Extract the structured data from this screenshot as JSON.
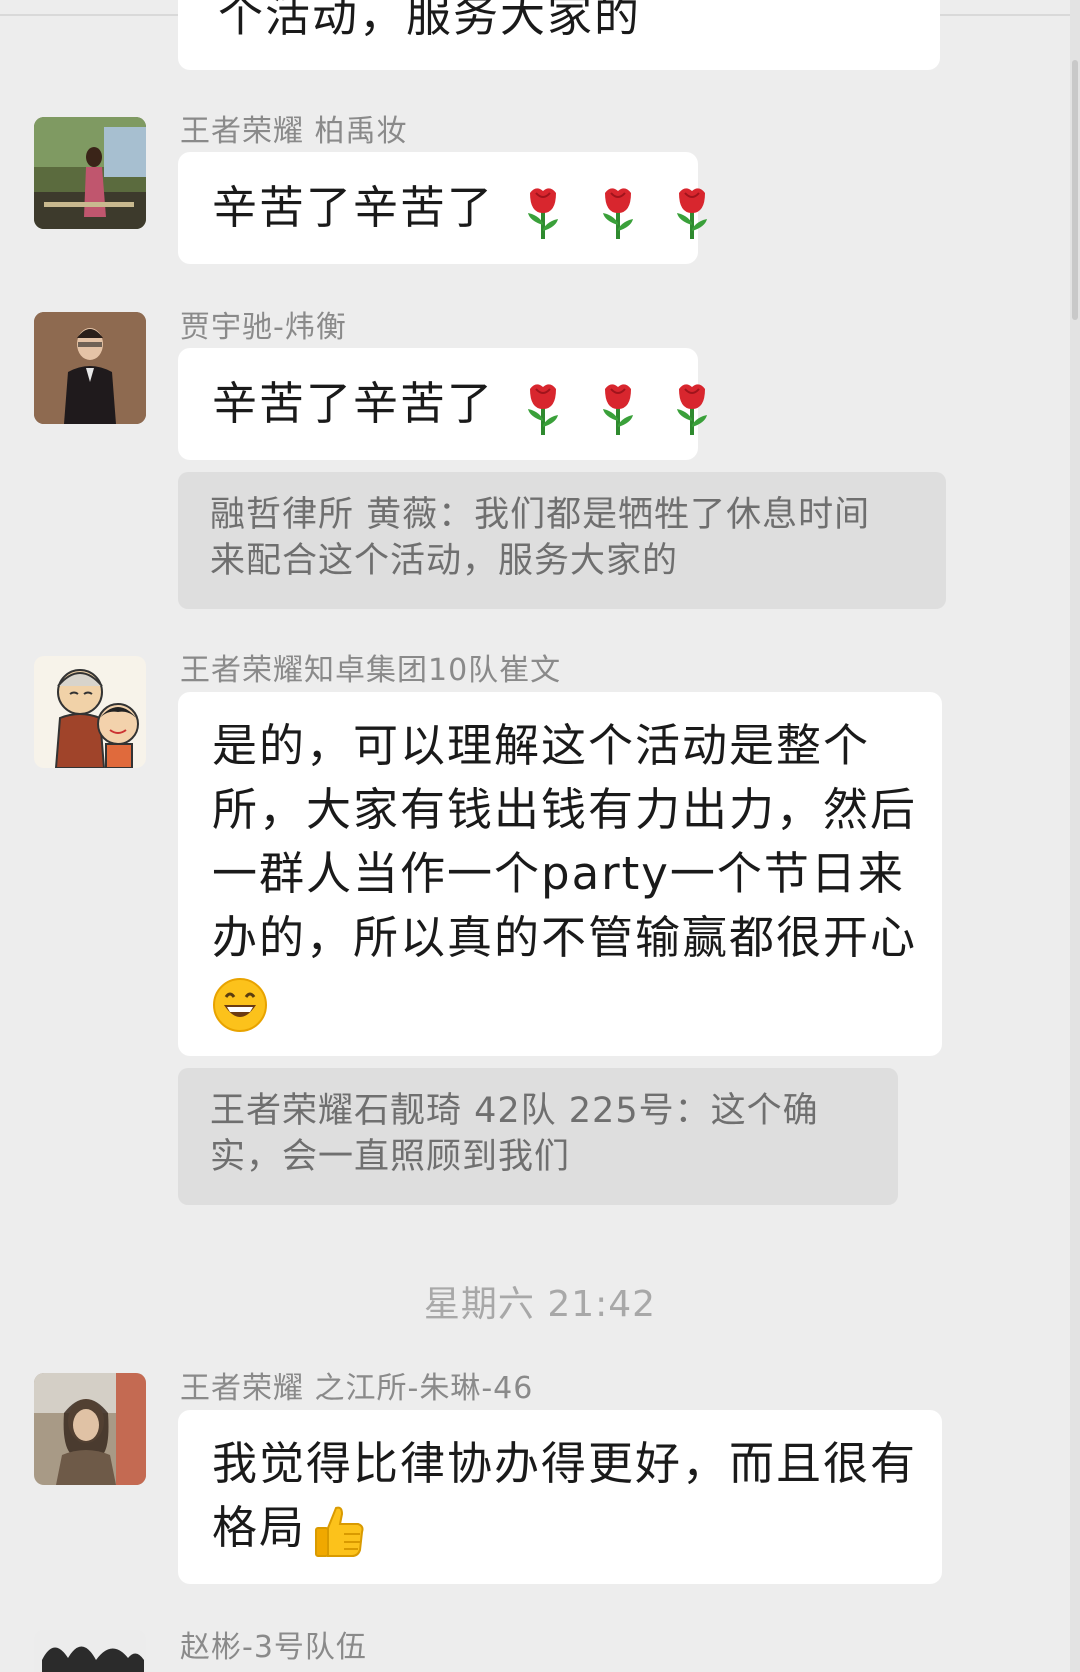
{
  "colors": {
    "background": "#ededed",
    "bubble": "#ffffff",
    "quote_bg": "#dedede",
    "name_text": "#8a8a8a"
  },
  "top_cut_text": "个活动，服务大家的",
  "messages": [
    {
      "sender": "王者荣耀 柏禹妆",
      "text": "辛苦了辛苦了",
      "emoji": [
        "rose-icon",
        "rose-icon",
        "rose-icon"
      ]
    },
    {
      "sender": "贾宇驰-炜衡",
      "text": "辛苦了辛苦了",
      "emoji": [
        "rose-icon",
        "rose-icon",
        "rose-icon"
      ],
      "quote": {
        "line1": "融哲律所 黄薇：我们都是牺牲了休息时间",
        "line2": "来配合这个活动，服务大家的"
      }
    },
    {
      "sender": "王者荣耀知卓集团10队崔文",
      "lines": [
        "是的，可以理解这个活动是整个",
        "所，大家有钱出钱有力出力，然后",
        "一群人当作一个party一个节日来",
        "办的，所以真的不管输赢都很开心"
      ],
      "emoji": [
        "grin-icon"
      ],
      "quote": {
        "line1": "王者荣耀石靓琦 42队 225号：这个确",
        "line2": "实，会一直照顾到我们"
      }
    },
    {
      "sender": "王者荣耀 之江所-朱琳-46",
      "lines": [
        "我觉得比律协办得更好，而且很有",
        "格局"
      ],
      "emoji": [
        "thumbs-up-icon"
      ]
    },
    {
      "sender": "赵彬-3号队伍"
    }
  ],
  "timestamp": "星期六 21:42"
}
